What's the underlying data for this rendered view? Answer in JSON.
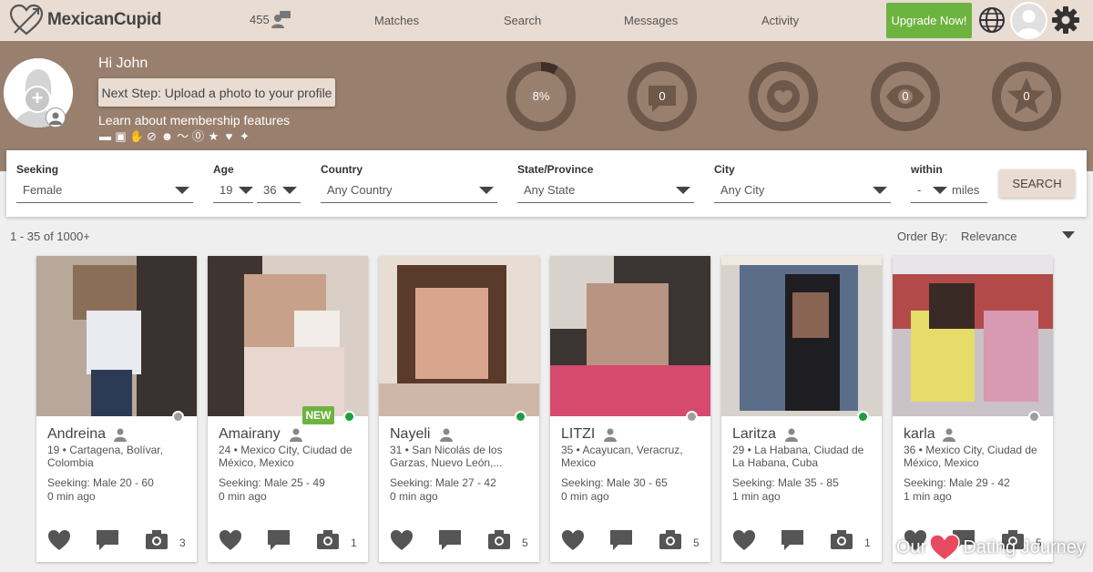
{
  "nav": {
    "logo_text": "MexicanCupid",
    "count": "455",
    "links": [
      "Matches",
      "Search",
      "Messages",
      "Activity"
    ],
    "upgrade_label": "Upgrade Now!"
  },
  "profile": {
    "greeting": "Hi John",
    "next_step": "Next Step: Upload a photo to your profile",
    "learn_link": "Learn about membership features",
    "stats": [
      {
        "label": "8%",
        "value": 0.08,
        "icon": "percent-ring"
      },
      {
        "label": "0",
        "icon": "message-icon"
      },
      {
        "label": "",
        "icon": "heart-icon"
      },
      {
        "label": "0",
        "icon": "eye-icon"
      },
      {
        "label": "0",
        "icon": "star-icon"
      }
    ]
  },
  "filters": {
    "seeking": {
      "label": "Seeking",
      "value": "Female"
    },
    "age": {
      "label": "Age",
      "min": "19",
      "max": "36"
    },
    "country": {
      "label": "Country",
      "value": "Any Country"
    },
    "state": {
      "label": "State/Province",
      "value": "Any State"
    },
    "city": {
      "label": "City",
      "value": "Any City"
    },
    "within": {
      "label": "within",
      "value": "-",
      "unit": "miles"
    },
    "search_label": "SEARCH"
  },
  "results": {
    "count_text": "1 - 35 of 1000+",
    "order_label": "Order By:",
    "order_value": "Relevance"
  },
  "cards": [
    {
      "name": "Andreina",
      "location": "19 • Cartagena, Bolívar, Colombia",
      "seeking": "Seeking: Male 20 - 60",
      "ago": "0 min ago",
      "photos": "3",
      "online": false,
      "new": false
    },
    {
      "name": "Amairany",
      "location": "24 • Mexico City, Ciudad de México, Mexico",
      "seeking": "Seeking: Male 25 - 49",
      "ago": "0 min ago",
      "photos": "1",
      "online": true,
      "new": true,
      "badge": "NEW"
    },
    {
      "name": "Nayeli",
      "location": "31 • San Nicolás de los Garzas, Nuevo León,...",
      "seeking": "Seeking: Male 27 - 42",
      "ago": "0 min ago",
      "photos": "5",
      "online": true,
      "new": false
    },
    {
      "name": "LITZI",
      "location": "35 • Acayucan, Veracruz, Mexico",
      "seeking": "Seeking: Male 30 - 65",
      "ago": "0 min ago",
      "photos": "5",
      "online": false,
      "new": false
    },
    {
      "name": "Laritza",
      "location": "29 • La Habana, Ciudad de La Habana, Cuba",
      "seeking": "Seeking: Male 35 - 85",
      "ago": "1 min ago",
      "photos": "1",
      "online": true,
      "new": false
    },
    {
      "name": "karla",
      "location": "36 • Mexico City, Ciudad de México, Mexico",
      "seeking": "Seeking: Male 29 - 42",
      "ago": "1 min ago",
      "photos": "5",
      "online": false,
      "new": false
    }
  ],
  "watermark": {
    "left": "Our",
    "right": "Dating Journey"
  },
  "colors": {
    "band": "#997f6d",
    "nav": "#e8dcd3",
    "upgrade": "#6cb33f",
    "online": "#1e9e3e",
    "offline": "#9e9e9e"
  }
}
